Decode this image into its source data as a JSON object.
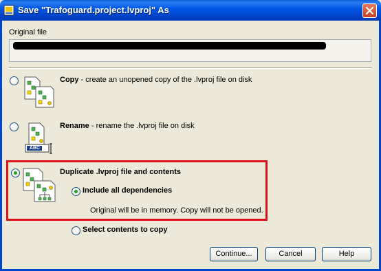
{
  "window": {
    "title": "Save \"Trafoguard.project.lvproj\" As"
  },
  "original_file": {
    "label": "Original file",
    "path_redacted": true
  },
  "options": [
    {
      "id": "copy",
      "title": "Copy",
      "description": " - create an unopened copy of the .lvproj file on disk",
      "selected": false
    },
    {
      "id": "rename",
      "title": "Rename",
      "description": " - rename the .lvproj file on disk",
      "icon_text": "ABC",
      "selected": false
    },
    {
      "id": "duplicate",
      "title": "Duplicate .lvproj file and contents",
      "selected": true
    }
  ],
  "sub_options": [
    {
      "id": "include_all",
      "label": "Include all dependencies",
      "selected": true
    },
    {
      "id": "select_contents",
      "label": "Select contents to copy",
      "selected": false
    }
  ],
  "note": "Original will be in memory. Copy will not be opened.",
  "buttons": {
    "continue": "Continue...",
    "cancel": "Cancel",
    "help": "Help"
  },
  "colors": {
    "titlebar": "#0058e6",
    "dialog_bg": "#ece9d8",
    "highlight": "#e0101a"
  }
}
